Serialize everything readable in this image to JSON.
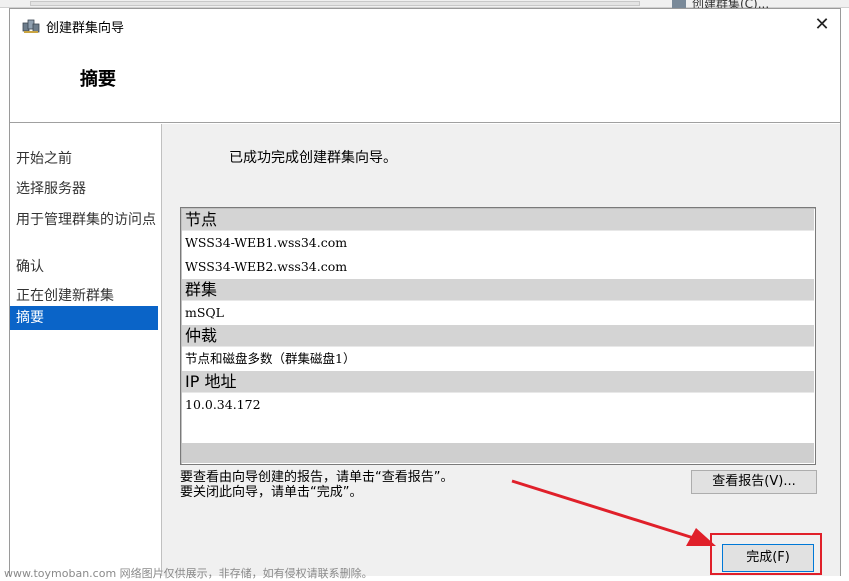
{
  "background": {
    "right_item": "创建群集(C)..."
  },
  "window": {
    "title": "创建群集向导",
    "close_symbol": "✕"
  },
  "header": {
    "title": "摘要"
  },
  "nav": {
    "items": [
      {
        "label": "开始之前",
        "selected": false
      },
      {
        "label": "选择服务器",
        "selected": false
      },
      {
        "label": "用于管理群集的访问点",
        "selected": false
      },
      {
        "label": "确认",
        "selected": false
      },
      {
        "label": "正在创建新群集",
        "selected": false
      },
      {
        "label": "摘要",
        "selected": true
      }
    ]
  },
  "content": {
    "success_message": "已成功完成创建群集向导。",
    "report": {
      "sections": [
        {
          "heading": "节点",
          "values": [
            "WSS34-WEB1.wss34.com",
            "WSS34-WEB2.wss34.com"
          ]
        },
        {
          "heading": "群集",
          "values": [
            "mSQL"
          ]
        },
        {
          "heading": "仲裁",
          "values": [
            "节点和磁盘多数（群集磁盘1）"
          ]
        },
        {
          "heading": "IP 地址",
          "values": [
            "10.0.34.172"
          ]
        }
      ]
    },
    "hint_line1": "要查看由向导创建的报告，请单击“查看报告”。",
    "hint_line2": "要关闭此向导，请单击“完成”。",
    "view_report_label": "查看报告(V)...",
    "finish_label": "完成(F)"
  },
  "watermark": "www.toymoban.com 网络图片仅供展示，非存储，如有侵权请联系删除。",
  "colors": {
    "selection": "#0a64c8",
    "annotation": "#e0202a"
  }
}
